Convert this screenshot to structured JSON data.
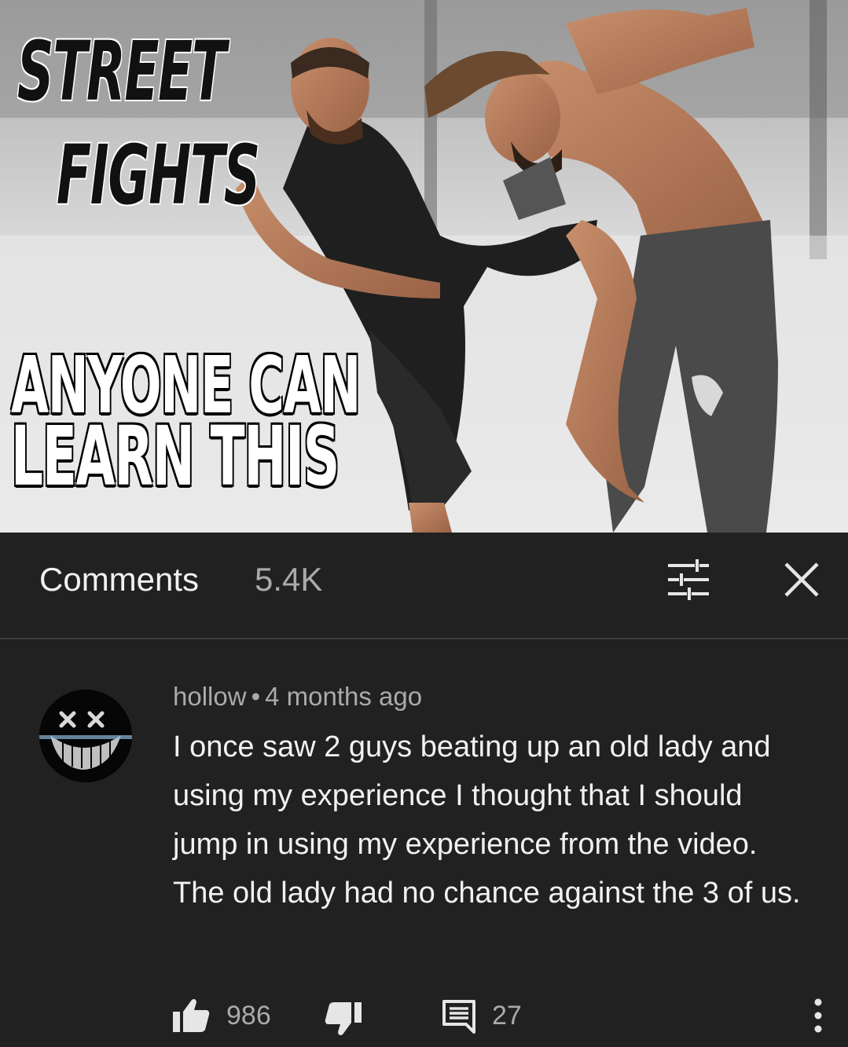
{
  "thumbnail": {
    "line1": "STREET",
    "line2": "FIGHTS",
    "line3": "ANYONE CAN",
    "line4": "LEARN THIS"
  },
  "comments_header": {
    "title": "Comments",
    "count": "5.4K",
    "filter_icon": "sort-filter-icon",
    "close_icon": "close-icon"
  },
  "comment": {
    "author": "hollow",
    "separator": "•",
    "time": "4 months ago",
    "text": "I once saw 2 guys beating up an old lady and using my experience I thought that I should jump in using my experience from the video. The old lady had no chance against the 3 of us.",
    "likes": "986",
    "replies": "27",
    "like_icon": "thumbs-up-icon",
    "dislike_icon": "thumbs-down-icon",
    "reply_icon": "reply-comment-icon",
    "more_icon": "more-vertical-icon"
  },
  "colors": {
    "background": "#212121",
    "primary_text": "#f1f1f1",
    "secondary_text": "#aaaaaa"
  }
}
